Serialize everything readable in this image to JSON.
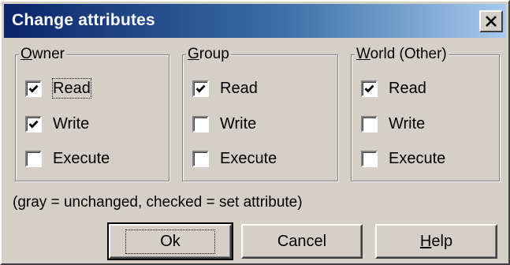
{
  "dialog": {
    "title": "Change attributes",
    "close_glyph": "×"
  },
  "groups": [
    {
      "legend_key": "O",
      "legend_rest": "wner",
      "items": [
        {
          "label": "Read",
          "checked": true,
          "focused": true
        },
        {
          "label": "Write",
          "checked": true
        },
        {
          "label": "Execute",
          "checked": false
        }
      ]
    },
    {
      "legend_key": "G",
      "legend_rest": "roup",
      "items": [
        {
          "label": "Read",
          "checked": true
        },
        {
          "label": "Write",
          "checked": false
        },
        {
          "label": "Execute",
          "checked": false
        }
      ]
    },
    {
      "legend_key": "W",
      "legend_rest": "orld (Other)",
      "items": [
        {
          "label": "Read",
          "checked": true
        },
        {
          "label": "Write",
          "checked": false
        },
        {
          "label": "Execute",
          "checked": false
        }
      ]
    }
  ],
  "hint": "(gray = unchanged, checked = set attribute)",
  "buttons": {
    "ok": "Ok",
    "cancel": "Cancel",
    "help_key": "H",
    "help_rest": "elp"
  },
  "icons": {
    "close": "close-icon",
    "check": "checkmark-icon"
  },
  "colors": {
    "face": "#d4d0c8",
    "title_start": "#0a246a",
    "title_end": "#a6caf0",
    "title_text": "#ffffff"
  }
}
